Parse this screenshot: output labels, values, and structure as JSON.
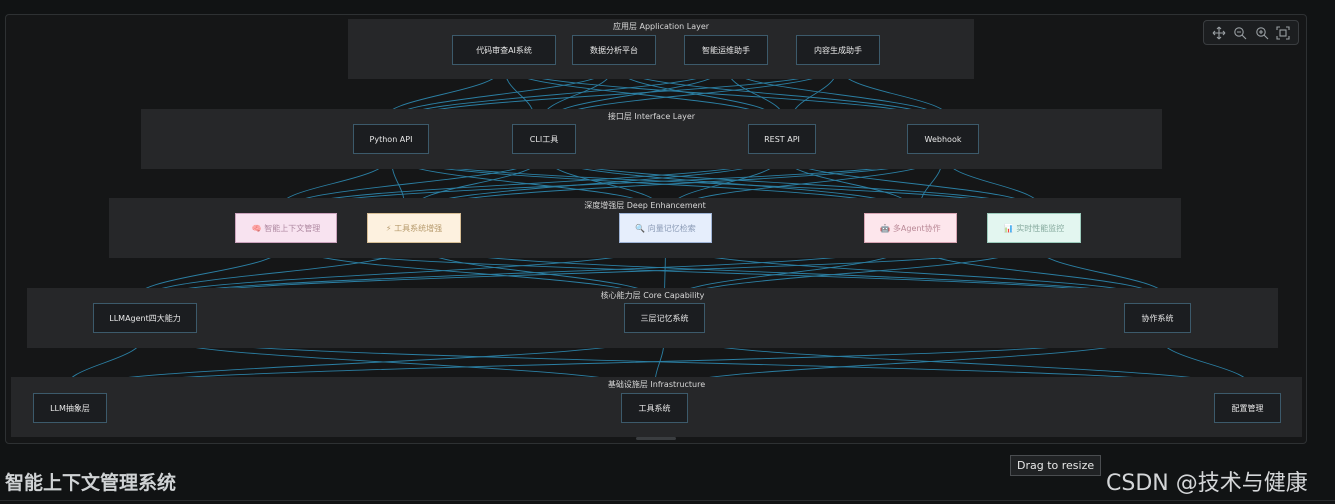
{
  "layers": {
    "app": "应用层 Application Layer",
    "interface": "接口层 Interface Layer",
    "enhance": "深度增强层 Deep Enhancement",
    "core": "核心能力层 Core Capability",
    "infra": "基础设施层 Infrastructure"
  },
  "nodes": {
    "code_review": "代码审查AI系统",
    "data_platform": "数据分析平台",
    "ops_assistant": "智能运维助手",
    "content_assistant": "内容生成助手",
    "python_api": "Python API",
    "cli_tool": "CLI工具",
    "rest_api": "REST API",
    "webhook": "Webhook",
    "context_mgmt": "🧠 智能上下文管理",
    "tool_enhance": "⚡ 工具系统增强",
    "vector_memory": "🔍 向量记忆检索",
    "multi_agent": "🤖 多Agent协作",
    "perf_monitor": "📊 实时性能监控",
    "llmagent": "LLMAgent四大能力",
    "memory3": "三层记忆系统",
    "collab": "协作系统",
    "llm_abstract": "LLM抽象层",
    "tools_sys": "工具系统",
    "config_mgmt": "配置管理"
  },
  "colors": {
    "edge": "#2b7fa3",
    "layer_bg": "#262729",
    "node_bg": "#1b1d20"
  },
  "toolbar": {
    "pan_icon": "move-icon",
    "zoom_out_icon": "zoom-out-icon",
    "zoom_in_icon": "zoom-in-icon",
    "fit_icon": "fit-screen-icon"
  },
  "page": {
    "title": "智能上下文管理系统",
    "tooltip": "Drag to resize",
    "watermark": "CSDN @技术与健康"
  }
}
